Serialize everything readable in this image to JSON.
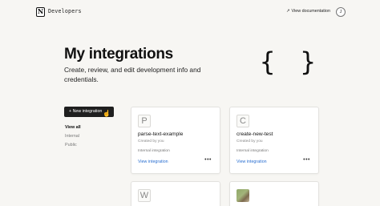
{
  "header": {
    "logo_glyph": "N",
    "brand": "Developers",
    "view_docs_arrow": "↗",
    "view_docs": "View documentation",
    "avatar_initial": "J"
  },
  "hero": {
    "title": "My integrations",
    "subtitle": "Create, review, and edit development info and credentials.",
    "braces": "{ }"
  },
  "sidebar": {
    "new_button": "+ New integration",
    "filters": [
      {
        "label": "View all",
        "active": true
      },
      {
        "label": "Internal",
        "active": false
      },
      {
        "label": "Public",
        "active": false
      }
    ]
  },
  "integrations": [
    {
      "initial": "P",
      "name": "parse-text-example",
      "created": "Created by you",
      "type": "Internal integration",
      "link": "View integration",
      "more": "•••"
    },
    {
      "initial": "C",
      "name": "create-new-test",
      "created": "Created by you",
      "type": "Internal integration",
      "link": "View integration",
      "more": "•••"
    },
    {
      "initial": "W"
    },
    {
      "initial": ""
    }
  ]
}
